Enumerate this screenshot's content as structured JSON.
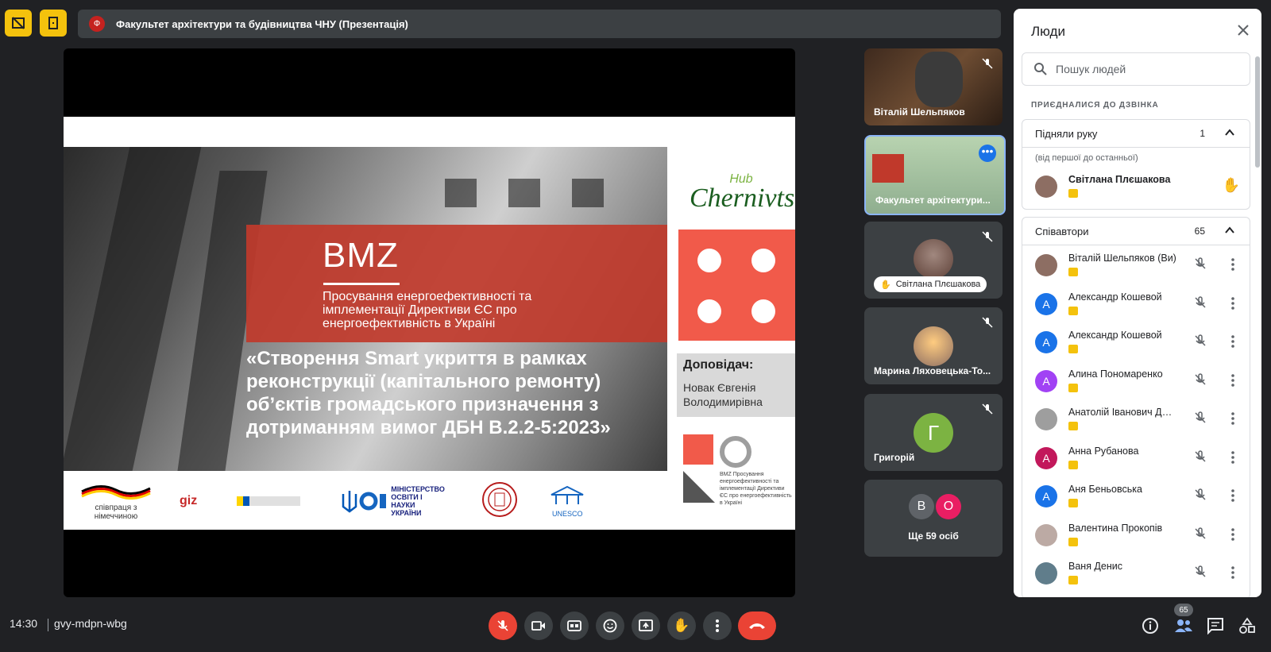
{
  "meeting": {
    "title_initial": "Ф",
    "title": "Факультет архітектури та будівництва ЧНУ (Презентація)",
    "time": "14:30",
    "code": "gvy-mdpn-wbg"
  },
  "slide": {
    "bmz": "BMZ",
    "bmz_subtitle": "Просування енергоефективності та імплементації Директиви ЄС про енергоефективність в Україні",
    "quote": "«Створення Smart укриття в рамках реконструкції (капітального ремонту) об’єктів громадського призначення з дотриманням вимог ДБН В.2.2-5:2023»",
    "hub_top": "Hub",
    "hub_bottom": "Chernivtsi",
    "speaker_title": "Доповідач:",
    "speaker_name": "Новак Євгенія Володимирівна",
    "logo_germany": "співпраця з німеччиною",
    "logo_giz": "giz",
    "logo_ministry": "МІНІСТЕРСТВО ОСВІТИ І НАУКИ УКРАЇНИ",
    "logo_unesco": "UNESCO",
    "bmz_small_text": "BMZ Просування енергоефективності та імплементації Директиви ЄС про енергоефективність в Україні"
  },
  "tiles": [
    {
      "name": "Віталій Шельпяков"
    },
    {
      "name": "Факультет архітектури..."
    },
    {
      "name": "Світлана Плєшакова"
    },
    {
      "name": "Марина Ляховецька-То..."
    },
    {
      "name": "Григорій",
      "initial": "Г"
    },
    {
      "name": "Ще 59 осіб",
      "initials": [
        "В",
        "О"
      ]
    }
  ],
  "people_panel": {
    "title": "Люди",
    "search_placeholder": "Пошук людей",
    "joined_label": "ПРИЄДНАЛИСЯ ДО ДЗВІНКА",
    "raised": {
      "label": "Підняли руку",
      "count": "1",
      "order": "(від першої до останньої)",
      "person": "Світлана Плєшакова"
    },
    "coauthors": {
      "label": "Співавтори",
      "count": "65",
      "people": [
        {
          "name": "Віталій Шельпяков (Ви)",
          "initial": "",
          "color": "#8d6e63"
        },
        {
          "name": "Александр Кошевой",
          "initial": "А",
          "color": "#1a73e8"
        },
        {
          "name": "Александр Кошевой",
          "initial": "А",
          "color": "#1a73e8"
        },
        {
          "name": "Алина Пономаренко",
          "initial": "А",
          "color": "#a142f4"
        },
        {
          "name": "Анатолій Іванович Дов...",
          "initial": "",
          "color": "#9e9e9e"
        },
        {
          "name": "Анна Рубанова",
          "initial": "А",
          "color": "#c2185b"
        },
        {
          "name": "Аня Беньовська",
          "initial": "А",
          "color": "#1a73e8"
        },
        {
          "name": "Валентина Прокопів",
          "initial": "",
          "color": "#bcaaa4"
        },
        {
          "name": "Ваня Денис",
          "initial": "",
          "color": "#607d8b"
        }
      ]
    }
  },
  "participants_count": "65",
  "colors": {
    "accent_red": "#ea4335",
    "yellow": "#f4c20d",
    "panel_bg": "#ffffff"
  }
}
